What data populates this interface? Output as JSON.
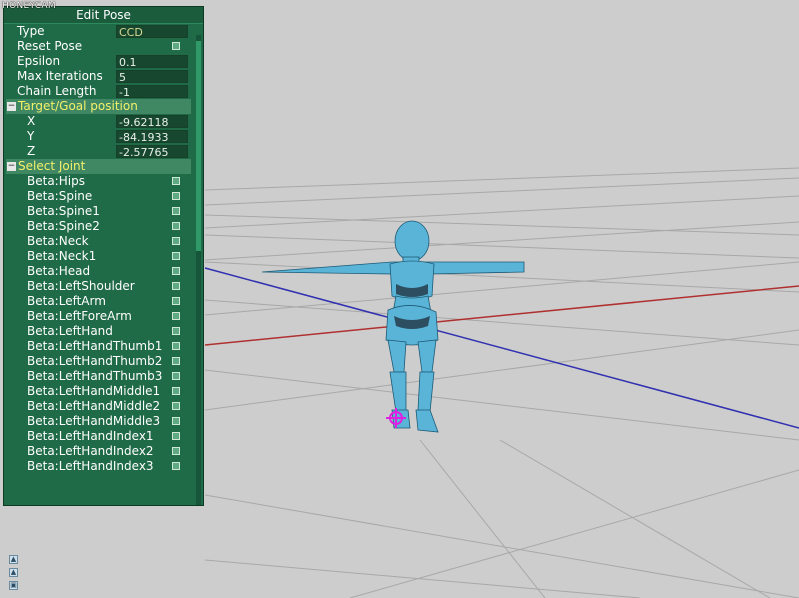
{
  "watermark": "HONEYCAM",
  "panel": {
    "title": "Edit Pose",
    "type_label": "Type",
    "type_value": "CCD",
    "reset_pose_label": "Reset Pose",
    "epsilon_label": "Epsilon",
    "epsilon_value": "0.1",
    "max_iterations_label": "Max Iterations",
    "max_iterations_value": "5",
    "chain_length_label": "Chain Length",
    "chain_length_value": "-1",
    "target_section": "Target/Goal position",
    "x_label": "X",
    "x_value": "-9.62118",
    "y_label": "Y",
    "y_value": "-84.1933",
    "z_label": "Z",
    "z_value": "-2.57765",
    "select_joint_section": "Select Joint",
    "toggle_symbol": "−",
    "joints": [
      "Beta:Hips",
      "Beta:Spine",
      "Beta:Spine1",
      "Beta:Spine2",
      "Beta:Neck",
      "Beta:Neck1",
      "Beta:Head",
      "Beta:LeftShoulder",
      "Beta:LeftArm",
      "Beta:LeftForeArm",
      "Beta:LeftHand",
      "Beta:LeftHandThumb1",
      "Beta:LeftHandThumb2",
      "Beta:LeftHandThumb3",
      "Beta:LeftHandMiddle1",
      "Beta:LeftHandMiddle2",
      "Beta:LeftHandMiddle3",
      "Beta:LeftHandIndex1",
      "Beta:LeftHandIndex2",
      "Beta:LeftHandIndex3"
    ]
  },
  "viewport": {
    "background": "#cdcdcd",
    "grid_color": "#a8a8a8",
    "x_axis_color": "#b03030",
    "z_axis_color": "#3030b0",
    "model_color": "#5ab4d8",
    "target_marker_color": "#e020e0"
  },
  "toolbar_icons": [
    "arrow-up-icon",
    "arrow-up-icon",
    "view-icon"
  ]
}
